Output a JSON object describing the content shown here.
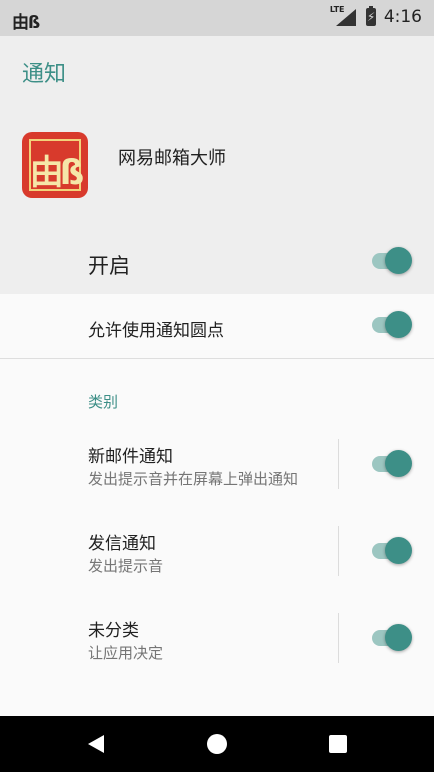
{
  "status_bar": {
    "app_indicator": "由ß",
    "network": "LTE",
    "time": "4:16"
  },
  "header": {
    "title": "通知",
    "app_icon_name": "mail-master-icon",
    "app_icon_glyph": "由ß",
    "app_name": "网易邮箱大师",
    "master_toggle_label": "开启",
    "master_toggle_on": true
  },
  "dot_setting": {
    "label": "允许使用通知圆点",
    "on": true
  },
  "categories_header": "类别",
  "categories": [
    {
      "label": "新邮件通知",
      "sub": "发出提示音并在屏幕上弹出通知",
      "on": true
    },
    {
      "label": "发信通知",
      "sub": "发出提示音",
      "on": true
    },
    {
      "label": "未分类",
      "sub": "让应用决定",
      "on": true
    }
  ],
  "colors": {
    "accent": "#3d8f87",
    "accent_track": "#9cc6c1",
    "header_bg": "#eeeeee",
    "icon_red": "#d83a2c"
  },
  "navbar": {
    "back": "back-icon",
    "home": "home-icon",
    "recent": "recent-apps-icon"
  }
}
